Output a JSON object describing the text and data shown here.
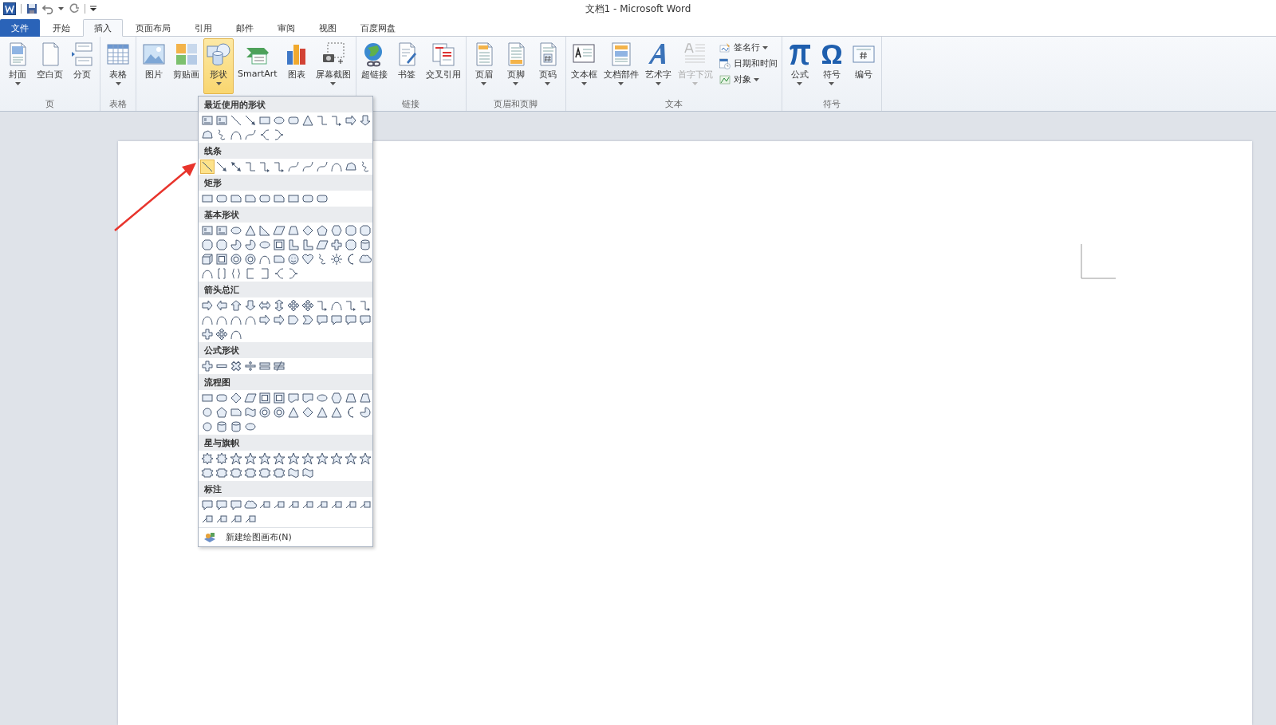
{
  "title_bar": {
    "title": "文档1  -  Microsoft Word"
  },
  "tabs": [
    {
      "label": "文件",
      "kind": "file",
      "selected": false
    },
    {
      "label": "开始",
      "kind": "tab",
      "selected": false
    },
    {
      "label": "插入",
      "kind": "tab",
      "selected": true
    },
    {
      "label": "页面布局",
      "kind": "tab",
      "selected": false
    },
    {
      "label": "引用",
      "kind": "tab",
      "selected": false
    },
    {
      "label": "邮件",
      "kind": "tab",
      "selected": false
    },
    {
      "label": "审阅",
      "kind": "tab",
      "selected": false
    },
    {
      "label": "视图",
      "kind": "tab",
      "selected": false
    },
    {
      "label": "百度网盘",
      "kind": "tab",
      "selected": false
    }
  ],
  "ribbon": {
    "groups": [
      {
        "label": "页",
        "buttons": [
          {
            "label": "封面",
            "kind": "cover",
            "has_caret": true,
            "selected": false,
            "disabled": false
          },
          {
            "label": "空白页",
            "kind": "blank",
            "has_caret": false,
            "selected": false,
            "disabled": false
          },
          {
            "label": "分页",
            "kind": "page-break",
            "has_caret": false,
            "selected": false,
            "disabled": false
          }
        ]
      },
      {
        "label": "表格",
        "buttons": [
          {
            "label": "表格",
            "kind": "table",
            "has_caret": true,
            "selected": false,
            "disabled": false
          }
        ]
      },
      {
        "buttons": [
          {
            "label": "图片",
            "kind": "picture",
            "has_caret": false,
            "selected": false,
            "disabled": false
          },
          {
            "label": "剪贴画",
            "kind": "clipart",
            "has_caret": false,
            "selected": false,
            "disabled": false
          },
          {
            "label": "形状",
            "kind": "shapes",
            "has_caret": true,
            "selected": true,
            "disabled": false
          },
          {
            "label": "SmartArt",
            "kind": "smartart",
            "has_caret": false,
            "selected": false,
            "disabled": false
          },
          {
            "label": "图表",
            "kind": "chart",
            "has_caret": false,
            "selected": false,
            "disabled": false
          },
          {
            "label": "屏幕截图",
            "kind": "screenshot",
            "has_caret": true,
            "selected": false,
            "disabled": false
          }
        ]
      },
      {
        "label": "链接",
        "buttons": [
          {
            "label": "超链接",
            "kind": "hyperlink",
            "has_caret": false,
            "selected": false,
            "disabled": false
          },
          {
            "label": "书签",
            "kind": "bookmark",
            "has_caret": false,
            "selected": false,
            "disabled": false
          },
          {
            "label": "交叉引用",
            "kind": "cross-reference",
            "has_caret": false,
            "selected": false,
            "disabled": false
          }
        ]
      },
      {
        "label": "页眉和页脚",
        "buttons": [
          {
            "label": "页眉",
            "kind": "header",
            "has_caret": true,
            "selected": false,
            "disabled": false
          },
          {
            "label": "页脚",
            "kind": "footer",
            "has_caret": true,
            "selected": false,
            "disabled": false
          },
          {
            "label": "页码",
            "kind": "page-number",
            "has_caret": true,
            "selected": false,
            "disabled": false
          }
        ]
      },
      {
        "label": "文本",
        "buttons": [
          {
            "label": "文本框",
            "kind": "textbox",
            "has_caret": true,
            "selected": false,
            "disabled": false
          },
          {
            "label": "文档部件",
            "kind": "quick-parts",
            "has_caret": true,
            "selected": false,
            "disabled": false
          },
          {
            "label": "艺术字",
            "kind": "wordart",
            "has_caret": true,
            "selected": false,
            "disabled": false
          },
          {
            "label": "首字下沉",
            "kind": "drop-cap",
            "has_caret": true,
            "selected": false,
            "disabled": true
          }
        ],
        "small_buttons": [
          {
            "label": "签名行",
            "kind": "signature",
            "has_caret": true
          },
          {
            "label": "日期和时间",
            "kind": "datetime",
            "has_caret": false
          },
          {
            "label": "对象",
            "kind": "object",
            "has_caret": true
          }
        ]
      },
      {
        "label": "符号",
        "buttons": [
          {
            "label": "公式",
            "kind": "equation",
            "has_caret": true,
            "selected": false,
            "disabled": false
          },
          {
            "label": "符号",
            "kind": "symbol",
            "has_caret": true,
            "selected": false,
            "disabled": false
          },
          {
            "label": "编号",
            "kind": "number",
            "has_caret": false,
            "selected": false,
            "disabled": false
          }
        ]
      }
    ]
  },
  "shapes_menu": {
    "sections": [
      {
        "title": "最近使用的形状",
        "shapes": [
          {
            "kind": "text-box",
            "selected": false
          },
          {
            "kind": "text-box",
            "selected": false
          },
          {
            "kind": "line",
            "selected": false
          },
          {
            "kind": "arrow",
            "selected": false
          },
          {
            "kind": "rectangle",
            "selected": false
          },
          {
            "kind": "oval",
            "selected": false
          },
          {
            "kind": "rounded-rectangle",
            "selected": false
          },
          {
            "kind": "triangle",
            "selected": false
          },
          {
            "kind": "elbow",
            "selected": false
          },
          {
            "kind": "elbow-arrow",
            "selected": false
          },
          {
            "kind": "right-arrow",
            "selected": false
          },
          {
            "kind": "down-arrow",
            "selected": false
          },
          {
            "kind": "freeform",
            "selected": false
          },
          {
            "kind": "scribble",
            "selected": false
          },
          {
            "kind": "arc",
            "selected": false
          },
          {
            "kind": "curve",
            "selected": false
          },
          {
            "kind": "left-brace",
            "selected": false
          },
          {
            "kind": "right-brace",
            "selected": false
          }
        ]
      },
      {
        "title": "线条",
        "shapes": [
          {
            "kind": "line",
            "selected": true
          },
          {
            "kind": "arrow",
            "selected": false
          },
          {
            "kind": "double-arrow",
            "selected": false
          },
          {
            "kind": "elbow",
            "selected": false
          },
          {
            "kind": "elbow-arrow",
            "selected": false
          },
          {
            "kind": "elbow-arrow",
            "selected": false
          },
          {
            "kind": "curve",
            "selected": false
          },
          {
            "kind": "curve",
            "selected": false
          },
          {
            "kind": "curve",
            "selected": false
          },
          {
            "kind": "arc",
            "selected": false
          },
          {
            "kind": "freeform",
            "selected": false
          },
          {
            "kind": "scribble",
            "selected": false
          }
        ]
      },
      {
        "title": "矩形",
        "shapes": [
          {
            "kind": "rectangle",
            "selected": false
          },
          {
            "kind": "rounded-rectangle",
            "selected": false
          },
          {
            "kind": "snip-rectangle",
            "selected": false
          },
          {
            "kind": "snip-rectangle",
            "selected": false
          },
          {
            "kind": "rounded-rectangle",
            "selected": false
          },
          {
            "kind": "snip-rectangle",
            "selected": false
          },
          {
            "kind": "rectangle",
            "selected": false
          },
          {
            "kind": "rounded-rectangle",
            "selected": false
          },
          {
            "kind": "rounded-rectangle",
            "selected": false
          }
        ]
      },
      {
        "title": "基本形状",
        "shapes": [
          {
            "kind": "text-box",
            "selected": false
          },
          {
            "kind": "text-box",
            "selected": false
          },
          {
            "kind": "oval",
            "selected": false
          },
          {
            "kind": "triangle",
            "selected": false
          },
          {
            "kind": "right-triangle",
            "selected": false
          },
          {
            "kind": "parallelogram",
            "selected": false
          },
          {
            "kind": "trapezoid",
            "selected": false
          },
          {
            "kind": "diamond",
            "selected": false
          },
          {
            "kind": "pentagon",
            "selected": false
          },
          {
            "kind": "hexagon",
            "selected": false
          },
          {
            "kind": "octagon",
            "selected": false
          },
          {
            "kind": "octagon",
            "selected": false
          },
          {
            "kind": "octagon",
            "selected": false
          },
          {
            "kind": "octagon",
            "selected": false
          },
          {
            "kind": "pie",
            "selected": false
          },
          {
            "kind": "pie",
            "selected": false
          },
          {
            "kind": "oval",
            "selected": false
          },
          {
            "kind": "frame",
            "selected": false
          },
          {
            "kind": "l-shape",
            "selected": false
          },
          {
            "kind": "l-shape",
            "selected": false
          },
          {
            "kind": "parallelogram",
            "selected": false
          },
          {
            "kind": "cross",
            "selected": false
          },
          {
            "kind": "octagon",
            "selected": false
          },
          {
            "kind": "cylinder",
            "selected": false
          },
          {
            "kind": "cube",
            "selected": false
          },
          {
            "kind": "frame",
            "selected": false
          },
          {
            "kind": "donut",
            "selected": false
          },
          {
            "kind": "donut",
            "selected": false
          },
          {
            "kind": "arc",
            "selected": false
          },
          {
            "kind": "snip-rectangle",
            "selected": false
          },
          {
            "kind": "smiley",
            "selected": false
          },
          {
            "kind": "heart",
            "selected": false
          },
          {
            "kind": "scribble",
            "selected": false
          },
          {
            "kind": "sun",
            "selected": false
          },
          {
            "kind": "moon",
            "selected": false
          },
          {
            "kind": "cloud",
            "selected": false
          },
          {
            "kind": "arc",
            "selected": false
          },
          {
            "kind": "bracket",
            "selected": false
          },
          {
            "kind": "brace",
            "selected": false
          },
          {
            "kind": "left-bracket",
            "selected": false
          },
          {
            "kind": "right-bracket",
            "selected": false
          },
          {
            "kind": "left-brace",
            "selected": false
          },
          {
            "kind": "right-brace",
            "selected": false
          }
        ]
      },
      {
        "title": "箭头总汇",
        "shapes": [
          {
            "kind": "right-arrow",
            "selected": false
          },
          {
            "kind": "left-arrow",
            "selected": false
          },
          {
            "kind": "up-arrow",
            "selected": false
          },
          {
            "kind": "down-arrow",
            "selected": false
          },
          {
            "kind": "left-right-arrow",
            "selected": false
          },
          {
            "kind": "up-down-arrow",
            "selected": false
          },
          {
            "kind": "quad-arrow",
            "selected": false
          },
          {
            "kind": "quad-arrow",
            "selected": false
          },
          {
            "kind": "elbow-arrow",
            "selected": false
          },
          {
            "kind": "arc",
            "selected": false
          },
          {
            "kind": "elbow-arrow",
            "selected": false
          },
          {
            "kind": "elbow-arrow",
            "selected": false
          },
          {
            "kind": "arc",
            "selected": false
          },
          {
            "kind": "arc",
            "selected": false
          },
          {
            "kind": "arc",
            "selected": false
          },
          {
            "kind": "arc",
            "selected": false
          },
          {
            "kind": "right-arrow",
            "selected": false
          },
          {
            "kind": "right-arrow",
            "selected": false
          },
          {
            "kind": "pentagon-arrow",
            "selected": false
          },
          {
            "kind": "chevron",
            "selected": false
          },
          {
            "kind": "callout",
            "selected": false
          },
          {
            "kind": "callout",
            "selected": false
          },
          {
            "kind": "callout",
            "selected": false
          },
          {
            "kind": "callout",
            "selected": false
          },
          {
            "kind": "cross",
            "selected": false
          },
          {
            "kind": "quad-arrow",
            "selected": false
          },
          {
            "kind": "arc",
            "selected": false
          }
        ]
      },
      {
        "title": "公式形状",
        "shapes": [
          {
            "kind": "plus",
            "selected": false
          },
          {
            "kind": "minus",
            "selected": false
          },
          {
            "kind": "multiply",
            "selected": false
          },
          {
            "kind": "divide",
            "selected": false
          },
          {
            "kind": "equal",
            "selected": false
          },
          {
            "kind": "not-equal",
            "selected": false
          }
        ]
      },
      {
        "title": "流程图",
        "shapes": [
          {
            "kind": "rectangle",
            "selected": false
          },
          {
            "kind": "rounded-rectangle",
            "selected": false
          },
          {
            "kind": "diamond",
            "selected": false
          },
          {
            "kind": "parallelogram",
            "selected": false
          },
          {
            "kind": "frame",
            "selected": false
          },
          {
            "kind": "frame",
            "selected": false
          },
          {
            "kind": "document",
            "selected": false
          },
          {
            "kind": "document",
            "selected": false
          },
          {
            "kind": "oval",
            "selected": false
          },
          {
            "kind": "hexagon",
            "selected": false
          },
          {
            "kind": "trapezoid",
            "selected": false
          },
          {
            "kind": "trapezoid",
            "selected": false
          },
          {
            "kind": "circle",
            "selected": false
          },
          {
            "kind": "pentagon",
            "selected": false
          },
          {
            "kind": "snip-rectangle",
            "selected": false
          },
          {
            "kind": "wave",
            "selected": false
          },
          {
            "kind": "donut",
            "selected": false
          },
          {
            "kind": "donut",
            "selected": false
          },
          {
            "kind": "triangle",
            "selected": false
          },
          {
            "kind": "diamond",
            "selected": false
          },
          {
            "kind": "triangle",
            "selected": false
          },
          {
            "kind": "triangle",
            "selected": false
          },
          {
            "kind": "moon",
            "selected": false
          },
          {
            "kind": "pie",
            "selected": false
          },
          {
            "kind": "circle",
            "selected": false
          },
          {
            "kind": "cylinder",
            "selected": false
          },
          {
            "kind": "cylinder",
            "selected": false
          },
          {
            "kind": "oval",
            "selected": false
          }
        ]
      },
      {
        "title": "星与旗帜",
        "shapes": [
          {
            "kind": "burst",
            "selected": false
          },
          {
            "kind": "burst",
            "selected": false
          },
          {
            "kind": "star",
            "selected": false
          },
          {
            "kind": "star",
            "selected": false
          },
          {
            "kind": "star",
            "selected": false
          },
          {
            "kind": "star",
            "selected": false
          },
          {
            "kind": "star",
            "selected": false
          },
          {
            "kind": "star",
            "selected": false
          },
          {
            "kind": "star",
            "selected": false
          },
          {
            "kind": "star",
            "selected": false
          },
          {
            "kind": "star",
            "selected": false
          },
          {
            "kind": "star",
            "selected": false
          },
          {
            "kind": "banner",
            "selected": false
          },
          {
            "kind": "banner",
            "selected": false
          },
          {
            "kind": "banner",
            "selected": false
          },
          {
            "kind": "banner",
            "selected": false
          },
          {
            "kind": "banner",
            "selected": false
          },
          {
            "kind": "banner",
            "selected": false
          },
          {
            "kind": "wave",
            "selected": false
          },
          {
            "kind": "wave",
            "selected": false
          }
        ]
      },
      {
        "title": "标注",
        "shapes": [
          {
            "kind": "callout",
            "selected": false
          },
          {
            "kind": "callout",
            "selected": false
          },
          {
            "kind": "callout",
            "selected": false
          },
          {
            "kind": "cloud",
            "selected": false
          },
          {
            "kind": "line-callout",
            "selected": false
          },
          {
            "kind": "line-callout",
            "selected": false
          },
          {
            "kind": "line-callout",
            "selected": false
          },
          {
            "kind": "line-callout",
            "selected": false
          },
          {
            "kind": "line-callout",
            "selected": false
          },
          {
            "kind": "line-callout",
            "selected": false
          },
          {
            "kind": "line-callout",
            "selected": false
          },
          {
            "kind": "line-callout",
            "selected": false
          },
          {
            "kind": "line-callout",
            "selected": false
          },
          {
            "kind": "line-callout",
            "selected": false
          },
          {
            "kind": "line-callout",
            "selected": false
          },
          {
            "kind": "line-callout",
            "selected": false
          }
        ]
      }
    ],
    "footer": {
      "label": "新建绘图画布(N)"
    }
  }
}
